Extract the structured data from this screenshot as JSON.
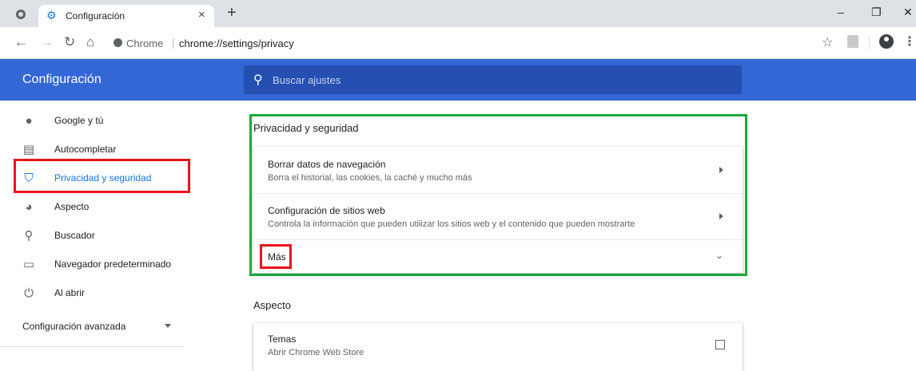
{
  "browser": {
    "tab_title": "Configuración",
    "tab_close": "×",
    "new_tab": "+",
    "window_controls": {
      "minimize": "–",
      "restore": "❐",
      "close": "✕"
    },
    "origin_chip": "Chrome",
    "url": "chrome://settings/privacy",
    "icons": [
      "globe-icon",
      "gear-favicon",
      "back-icon",
      "forward-icon",
      "reload-icon",
      "home-icon",
      "star-icon",
      "pdf-extension-icon",
      "profile-icon",
      "menu-icon"
    ]
  },
  "header": {
    "title": "Configuración",
    "search_placeholder": "Buscar ajustes"
  },
  "sidebar": {
    "items": [
      {
        "label": "Google y tú",
        "icon": "person-icon"
      },
      {
        "label": "Autocompletar",
        "icon": "clipboard-icon"
      },
      {
        "label": "Privacidad y seguridad",
        "icon": "shield-icon",
        "active": true
      },
      {
        "label": "Aspecto",
        "icon": "palette-icon"
      },
      {
        "label": "Buscador",
        "icon": "search-icon"
      },
      {
        "label": "Navegador predeterminado",
        "icon": "browser-icon"
      },
      {
        "label": "Al abrir",
        "icon": "power-icon"
      }
    ],
    "advanced_label": "Configuración avanzada"
  },
  "main": {
    "privacy": {
      "title": "Privacidad y seguridad",
      "rows": [
        {
          "title": "Borrar datos de navegación",
          "subtitle": "Borra el historial, las cookies, la caché y mucho más"
        },
        {
          "title": "Configuración de sitios web",
          "subtitle": "Controla la información que pueden utilizar los sitios web y el contenido que pueden mostrarte"
        }
      ],
      "more_label": "Más"
    },
    "appearance": {
      "title": "Aspecto",
      "themes_title": "Temas",
      "themes_subtitle": "Abrir Chrome Web Store"
    }
  },
  "colors": {
    "header_blue": "#3367d6",
    "accent_blue": "#1a73e8",
    "highlight_red": "#e8141f",
    "highlight_green": "#1aaa3a"
  }
}
